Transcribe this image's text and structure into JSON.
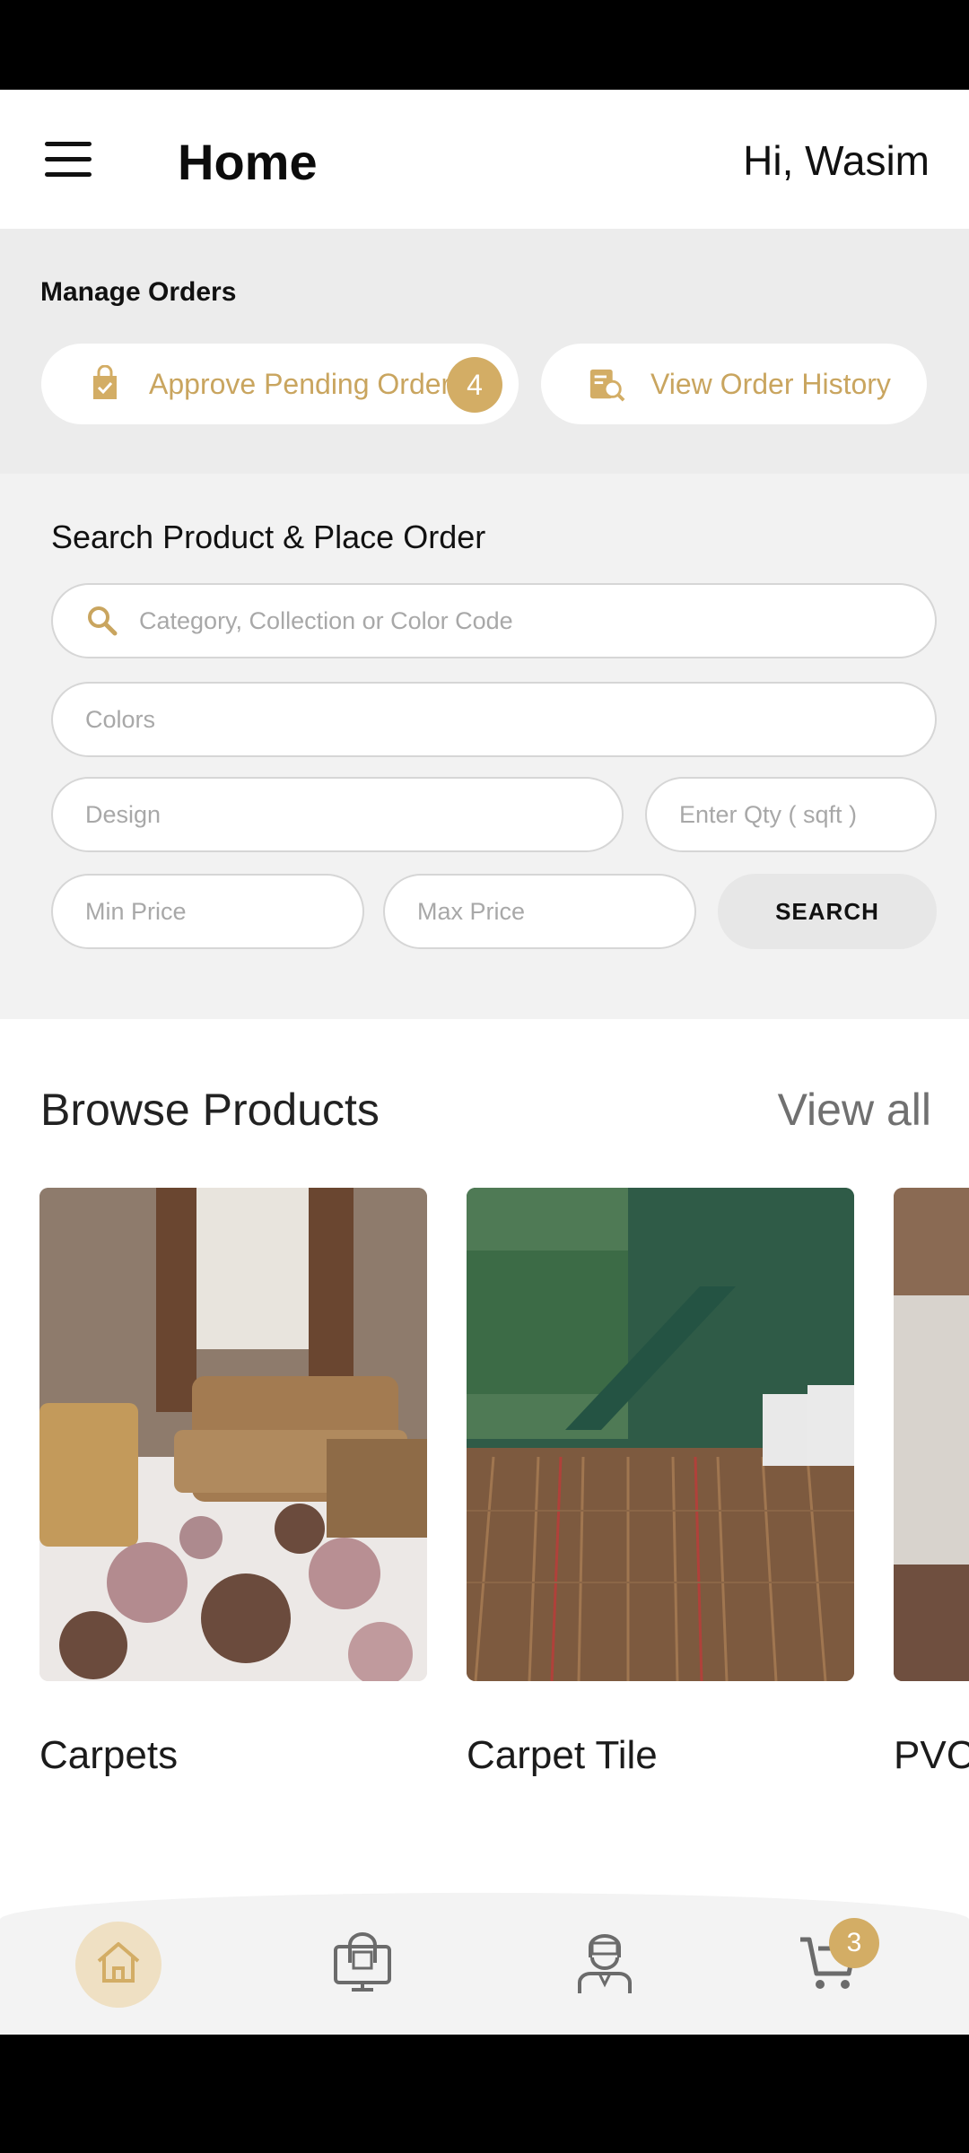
{
  "header": {
    "title": "Home",
    "greeting": "Hi, Wasim"
  },
  "manage_orders": {
    "title": "Manage Orders",
    "approve_label": "Approve Pending Order",
    "approve_count": "4",
    "history_label": "View Order History"
  },
  "search": {
    "title": "Search Product & Place Order",
    "main_placeholder": "Category, Collection or Color Code",
    "colors_placeholder": "Colors",
    "design_placeholder": "Design",
    "qty_placeholder": "Enter Qty ( sqft )",
    "min_price_placeholder": "Min Price",
    "max_price_placeholder": "Max Price",
    "button_label": "SEARCH"
  },
  "browse": {
    "title": "Browse Products",
    "view_all": "View all",
    "products": [
      {
        "name": "Carpets"
      },
      {
        "name": "Carpet Tile"
      },
      {
        "name": "PVC"
      }
    ]
  },
  "bottom_nav": {
    "cart_count": "3",
    "accent": "#d3ad65",
    "items": [
      "home-icon",
      "orders-icon",
      "support-icon",
      "cart-icon"
    ]
  }
}
